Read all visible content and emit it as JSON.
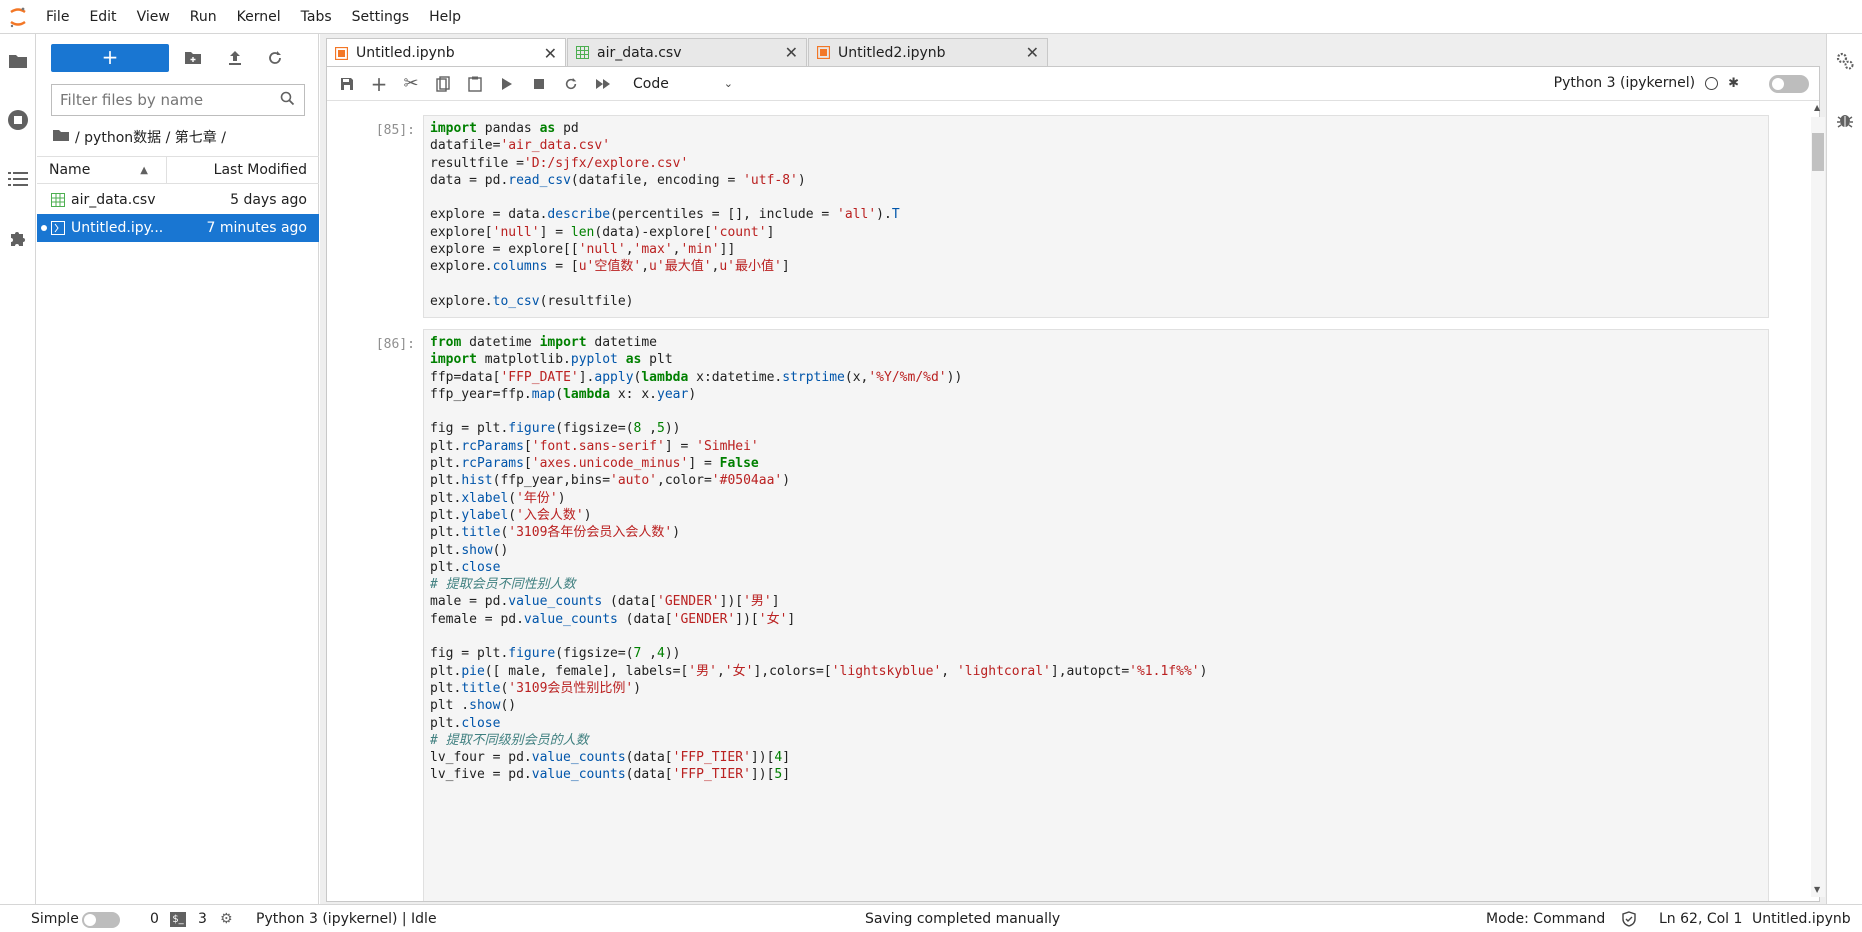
{
  "menu": [
    "File",
    "Edit",
    "View",
    "Run",
    "Kernel",
    "Tabs",
    "Settings",
    "Help"
  ],
  "filebrowser": {
    "new_label": "+",
    "filter_placeholder": "Filter files by name",
    "breadcrumb": [
      "/ python数据 / 第七章 /"
    ],
    "col_name": "Name",
    "col_modified": "Last Modified",
    "files": [
      {
        "name": "air_data.csv",
        "modified": "5 days ago",
        "icon": "csv-icon",
        "selected": false
      },
      {
        "name": "Untitled.ipy...",
        "modified": "7 minutes ago",
        "icon": "notebook-icon",
        "selected": true
      }
    ]
  },
  "tabs": [
    {
      "label": "Untitled.ipynb",
      "icon": "notebook-icon",
      "active": true
    },
    {
      "label": "air_data.csv",
      "icon": "csv-icon",
      "active": false
    },
    {
      "label": "Untitled2.ipynb",
      "icon": "notebook-icon",
      "active": false
    }
  ],
  "toolbar": {
    "cell_type": "Code",
    "kernel": "Python 3 (ipykernel)"
  },
  "cells": [
    {
      "prompt": "[85]:"
    },
    {
      "prompt": "[86]:"
    }
  ],
  "status": {
    "mode_simple": "Simple",
    "count_a": "0",
    "count_b": "3",
    "kernel_state": "Python 3 (ipykernel) | Idle",
    "message": "Saving completed manually",
    "mode": "Mode: Command",
    "position": "Ln 62, Col 1",
    "filename": "Untitled.ipynb"
  },
  "colors": {
    "accent": "#1976d2",
    "selected_row": "#1976d2",
    "tab_icon": "#f37726",
    "csv_icon": "#4caf50"
  }
}
